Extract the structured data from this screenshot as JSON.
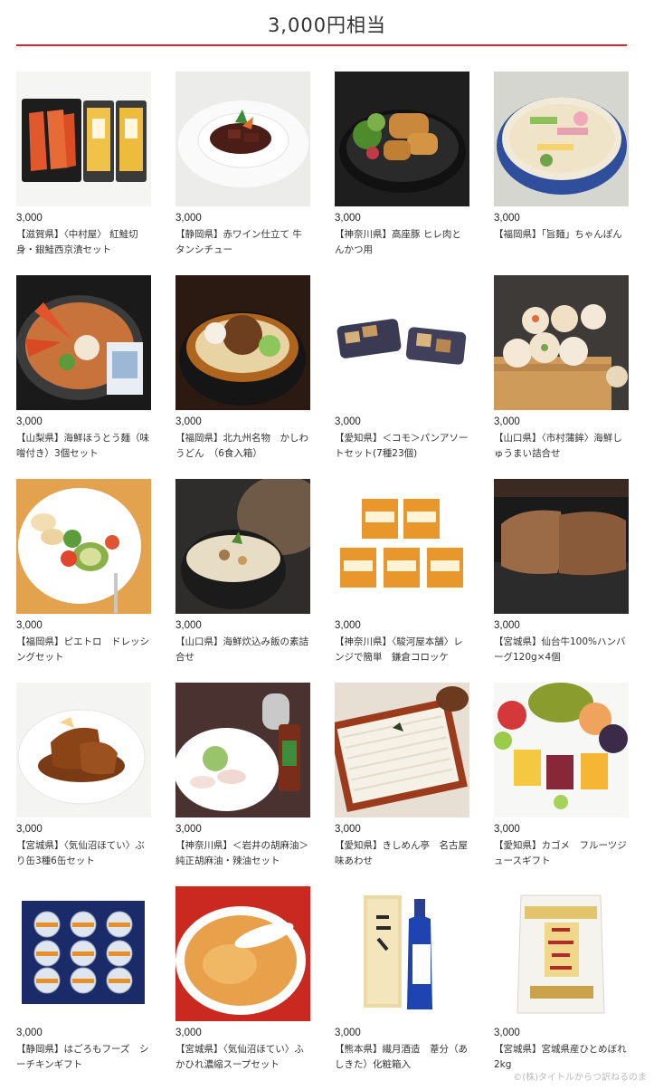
{
  "page": {
    "title": "3,000円相当",
    "accent_color": "#d7282f",
    "watermark": "©(株)タイトルからつ訳ねるのま"
  },
  "products": [
    {
      "price": "3,000",
      "name": "【滋賀県】〈中村屋〉 紅鮭切身・銀鮭西京漬セット",
      "image": "salmon-fillet-pack"
    },
    {
      "price": "3,000",
      "name": "【静岡県】赤ワイン仕立て 牛タンシチュー",
      "image": "beef-tongue-stew"
    },
    {
      "price": "3,000",
      "name": "【神奈川県】高座豚 ヒレ肉とんかつ用",
      "image": "pork-cutlet"
    },
    {
      "price": "3,000",
      "name": "【福岡県】「旨麺」ちゃんぽん",
      "image": "champon-noodles"
    },
    {
      "price": "3,000",
      "name": "【山梨県】海鮮ほうとう麺（味噌付き）3個セット",
      "image": "seafood-houtou-hotpot"
    },
    {
      "price": "3,000",
      "name": "【福岡県】北九州名物　かしわうどん　（6食入箱）",
      "image": "kashiwa-udon"
    },
    {
      "price": "3,000",
      "name": "【愛知県】＜コモ＞パンアソートセット(7種23個)",
      "image": "bread-assortment"
    },
    {
      "price": "3,000",
      "name": "【山口県】〈市村蒲鉾〉海鮮しゅうまい詰合せ",
      "image": "shumai-steamer"
    },
    {
      "price": "3,000",
      "name": "【福岡県】ピエトロ　ドレッシングセット",
      "image": "salad-plate"
    },
    {
      "price": "3,000",
      "name": "【山口県】海鮮炊込み飯の素詰合せ",
      "image": "mixed-rice-bowl"
    },
    {
      "price": "3,000",
      "name": "【神奈川県】〈駿河屋本舗〉レンジで簡単　鎌倉コロッケ",
      "image": "croquette-packs"
    },
    {
      "price": "3,000",
      "name": "【宮城県】仙台牛100%ハンバーグ120g×4個",
      "image": "hamburg-steak"
    },
    {
      "price": "3,000",
      "name": "【宮城県】〈気仙沼ほてい〉ぶり缶3種6缶セット",
      "image": "simmered-yellowtail"
    },
    {
      "price": "3,000",
      "name": "【神奈川県】＜岩井の胡麻油＞純正胡麻油・辣油セット",
      "image": "sesame-oil-carpaccio"
    },
    {
      "price": "3,000",
      "name": "【愛知県】きしめん亭　名古屋味あわせ",
      "image": "kishimen-noodles"
    },
    {
      "price": "3,000",
      "name": "【愛知県】カゴメ　フルーツジュースギフト",
      "image": "fruit-juice"
    },
    {
      "price": "3,000",
      "name": "【静岡県】はごろもフーズ　シーチキンギフト",
      "image": "tuna-can-gift"
    },
    {
      "price": "3,000",
      "name": "【宮城県】〈気仙沼ほてい〉ふかひれ濃縮スープセット",
      "image": "shark-fin-soup"
    },
    {
      "price": "3,000",
      "name": "【熊本県】繊月酒造　葦分（あしきた）化粧箱入",
      "image": "shochu-bottle"
    },
    {
      "price": "3,000",
      "name": "【宮城県】宮城県産ひとめぼれ2kg",
      "image": "rice-bag"
    }
  ],
  "artwork": {
    "salmon-fillet-pack": {
      "label": ""
    },
    "croquette-packs": {
      "label": "鎌倉コロッケ"
    },
    "rice-bag": {
      "label": "ひとめぼれ"
    },
    "shochu-bottle": {
      "label": "葦分"
    },
    "tuna-can-gift": {
      "label": "シーチキン"
    }
  }
}
